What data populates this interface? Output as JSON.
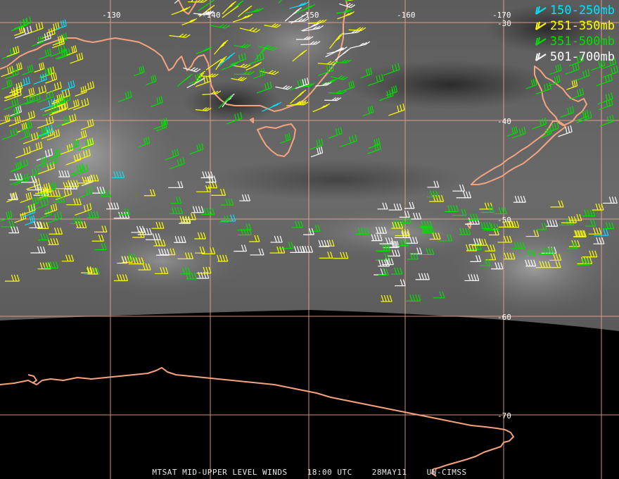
{
  "map": {
    "longitude_labels": [
      "-130",
      "-140",
      "-150",
      "-160",
      "-170"
    ],
    "latitude_labels": [
      "-30",
      "-40",
      "-50",
      "-60",
      "-70"
    ],
    "colors": {
      "graticule": "#f0a890",
      "coastline": "#f5a27f",
      "space": "#000000"
    }
  },
  "legend": {
    "items": [
      {
        "label": "150-250mb",
        "color": "#00e5ff"
      },
      {
        "label": "251-350mb",
        "color": "#ffff00"
      },
      {
        "label": "351-500mb",
        "color": "#00e000"
      },
      {
        "label": "501-700mb",
        "color": "#ffffff"
      }
    ]
  },
  "footer": {
    "product": "MTSAT MID-UPPER LEVEL WINDS",
    "time": "18:00 UTC",
    "date": "28MAY11",
    "source": "UW-CIMSS"
  }
}
